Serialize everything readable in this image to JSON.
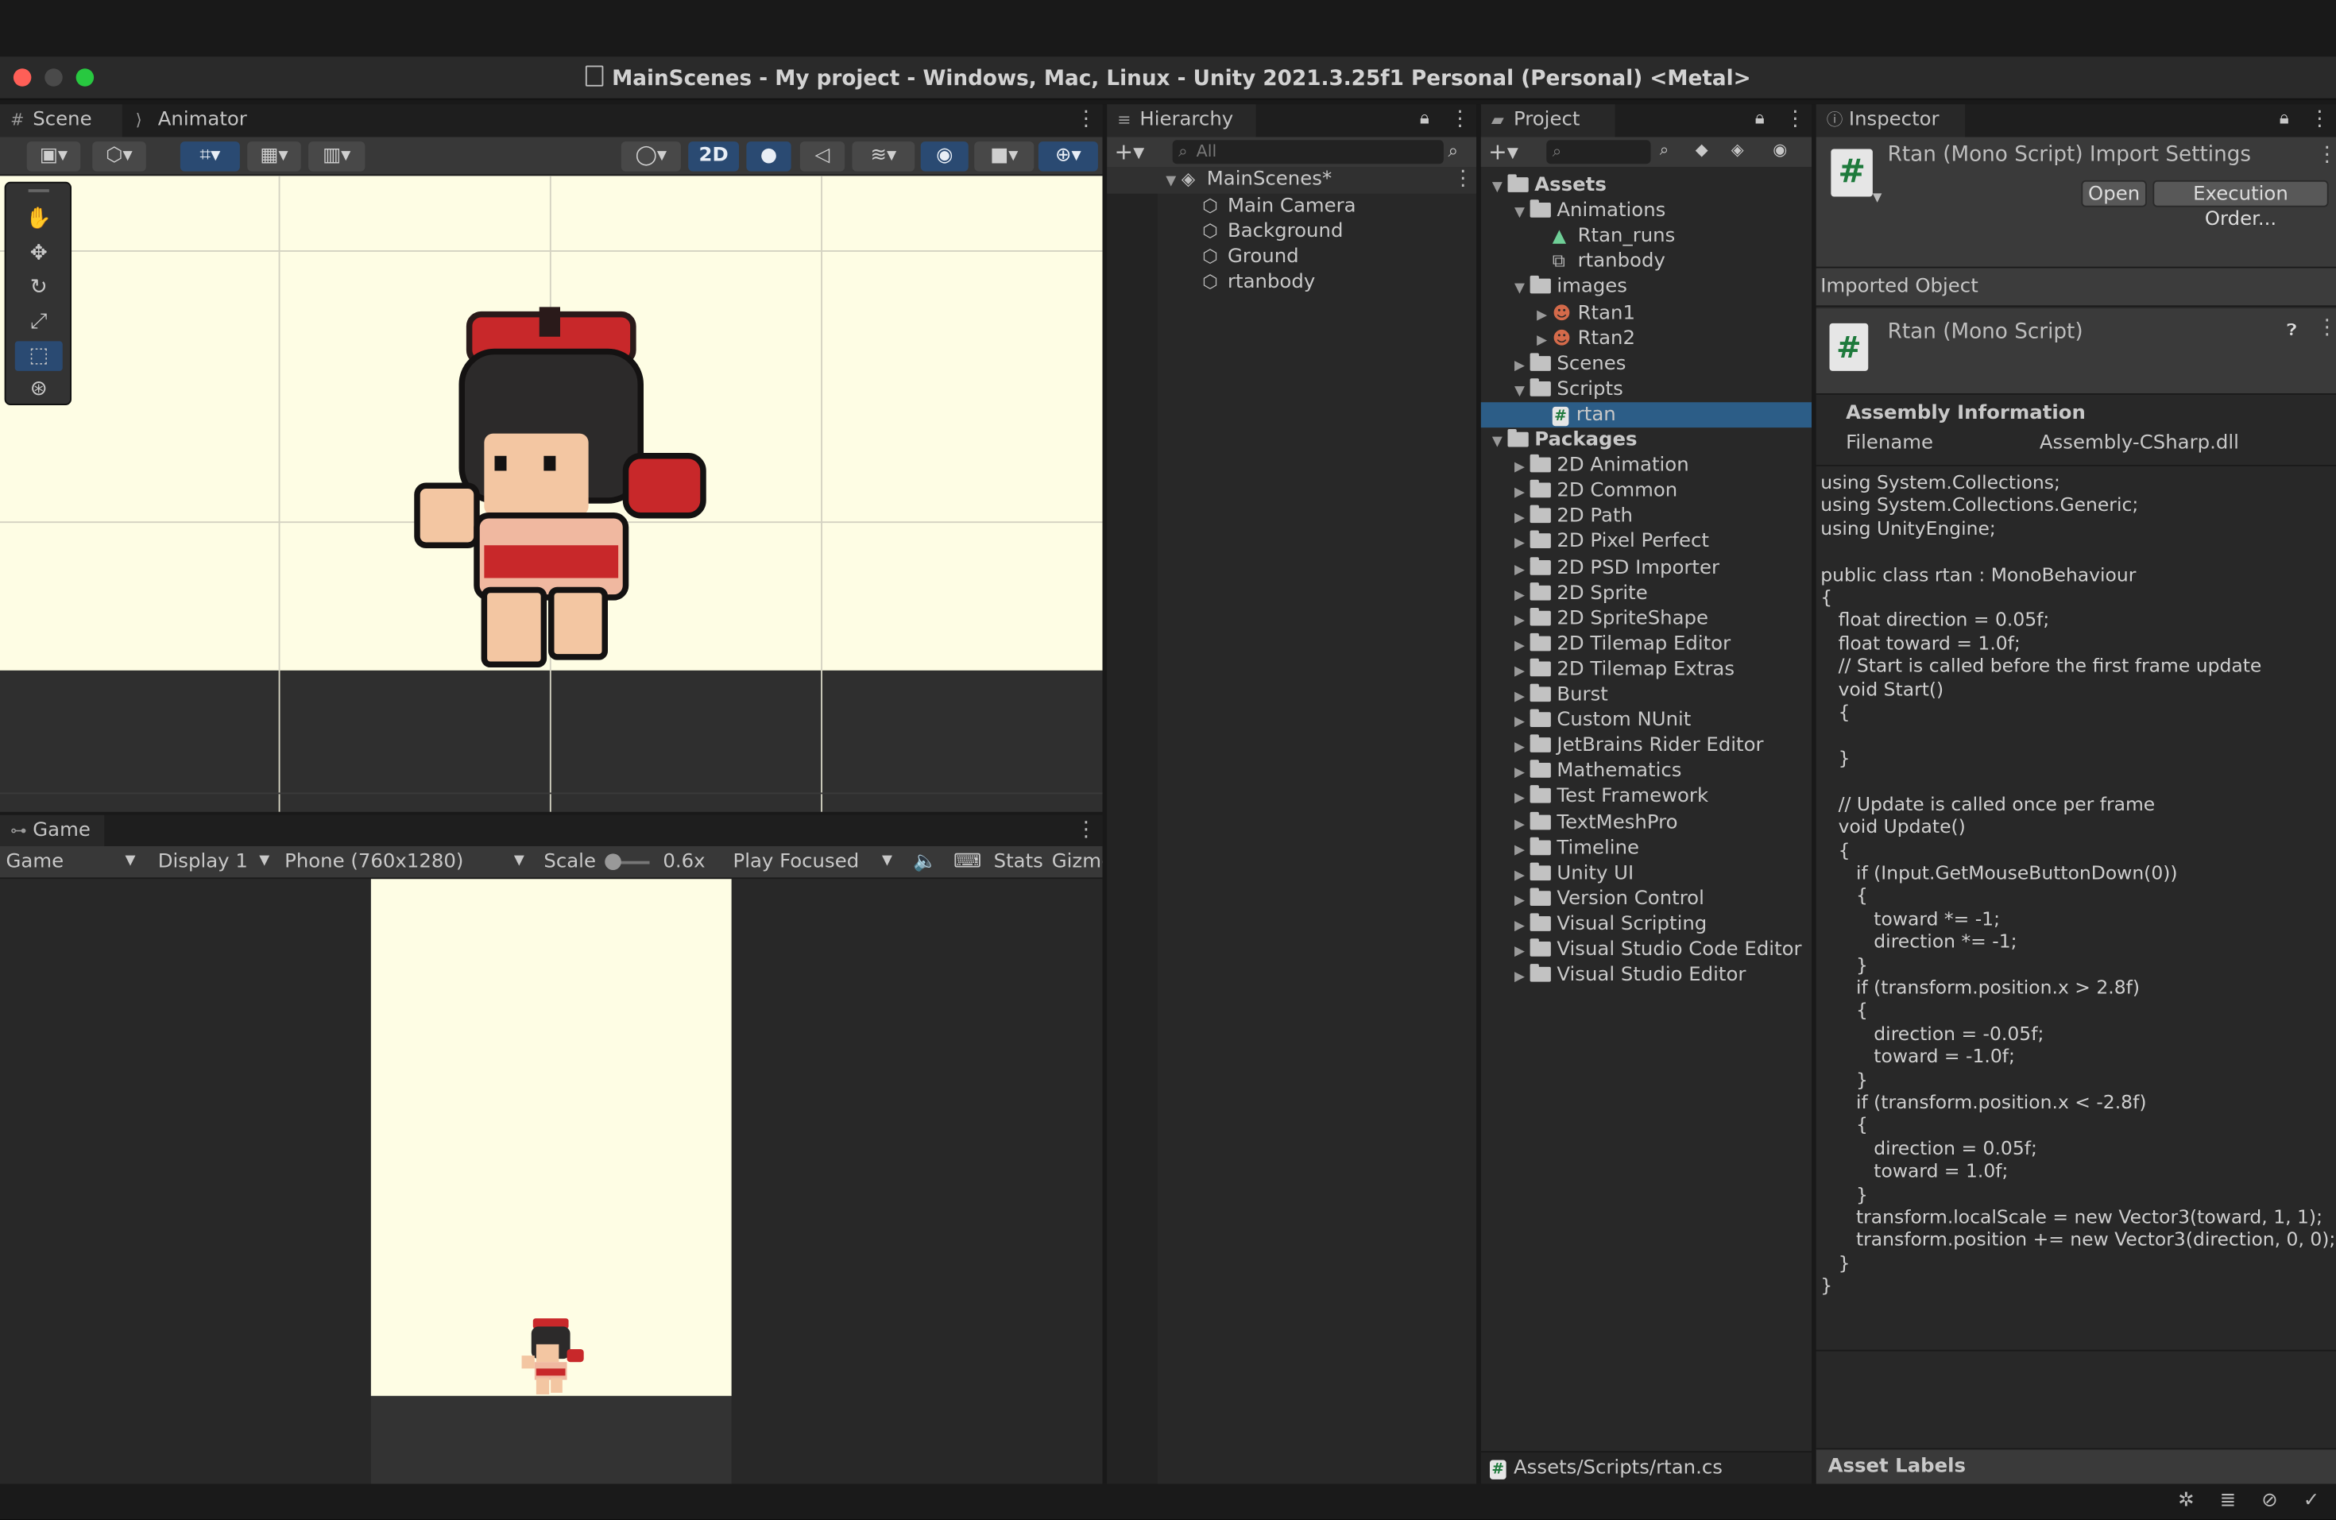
{
  "window": {
    "title": "MainScenes - My project - Windows, Mac, Linux - Unity 2021.3.25f1 Personal (Personal) <Metal>"
  },
  "scene": {
    "tabs": [
      {
        "label": "Scene"
      },
      {
        "label": "Animator"
      }
    ],
    "toolbar": {
      "mode2d_label": "2D"
    }
  },
  "game": {
    "tab_label": "Game",
    "toolbar": {
      "game_select": "Game",
      "display_select": "Display 1",
      "resolution_select": "Phone (760x1280)",
      "scale_label": "Scale",
      "scale_value": "0.6x",
      "play_mode_select": "Play Focused",
      "stats_label": "Stats",
      "gizmos_label": "Gizmo"
    }
  },
  "hierarchy": {
    "tab_label": "Hierarchy",
    "search_placeholder": "All",
    "scene_name": "MainScenes*",
    "items": [
      {
        "label": "Main Camera"
      },
      {
        "label": "Background"
      },
      {
        "label": "Ground"
      },
      {
        "label": "rtanbody"
      }
    ]
  },
  "project": {
    "tab_label": "Project",
    "tree": [
      {
        "label": "Assets",
        "indent": 0,
        "arrow": "down",
        "icon": "folder",
        "bold": true
      },
      {
        "label": "Animations",
        "indent": 1,
        "arrow": "down",
        "icon": "folder"
      },
      {
        "label": "Rtan_runs",
        "indent": 2,
        "arrow": "none",
        "icon": "anim"
      },
      {
        "label": "rtanbody",
        "indent": 2,
        "arrow": "none",
        "icon": "controller"
      },
      {
        "label": "images",
        "indent": 1,
        "arrow": "down",
        "icon": "folder"
      },
      {
        "label": "Rtan1",
        "indent": 2,
        "arrow": "right",
        "icon": "sprite"
      },
      {
        "label": "Rtan2",
        "indent": 2,
        "arrow": "right",
        "icon": "sprite"
      },
      {
        "label": "Scenes",
        "indent": 1,
        "arrow": "right",
        "icon": "folder"
      },
      {
        "label": "Scripts",
        "indent": 1,
        "arrow": "down",
        "icon": "folder"
      },
      {
        "label": "rtan",
        "indent": 2,
        "arrow": "none",
        "icon": "script",
        "selected": true
      },
      {
        "label": "Packages",
        "indent": 0,
        "arrow": "down",
        "icon": "folder",
        "bold": true
      },
      {
        "label": "2D Animation",
        "indent": 1,
        "arrow": "right",
        "icon": "folder"
      },
      {
        "label": "2D Common",
        "indent": 1,
        "arrow": "right",
        "icon": "folder"
      },
      {
        "label": "2D Path",
        "indent": 1,
        "arrow": "right",
        "icon": "folder"
      },
      {
        "label": "2D Pixel Perfect",
        "indent": 1,
        "arrow": "right",
        "icon": "folder"
      },
      {
        "label": "2D PSD Importer",
        "indent": 1,
        "arrow": "right",
        "icon": "folder"
      },
      {
        "label": "2D Sprite",
        "indent": 1,
        "arrow": "right",
        "icon": "folder"
      },
      {
        "label": "2D SpriteShape",
        "indent": 1,
        "arrow": "right",
        "icon": "folder"
      },
      {
        "label": "2D Tilemap Editor",
        "indent": 1,
        "arrow": "right",
        "icon": "folder"
      },
      {
        "label": "2D Tilemap Extras",
        "indent": 1,
        "arrow": "right",
        "icon": "folder"
      },
      {
        "label": "Burst",
        "indent": 1,
        "arrow": "right",
        "icon": "folder"
      },
      {
        "label": "Custom NUnit",
        "indent": 1,
        "arrow": "right",
        "icon": "folder"
      },
      {
        "label": "JetBrains Rider Editor",
        "indent": 1,
        "arrow": "right",
        "icon": "folder"
      },
      {
        "label": "Mathematics",
        "indent": 1,
        "arrow": "right",
        "icon": "folder"
      },
      {
        "label": "Test Framework",
        "indent": 1,
        "arrow": "right",
        "icon": "folder"
      },
      {
        "label": "TextMeshPro",
        "indent": 1,
        "arrow": "right",
        "icon": "folder"
      },
      {
        "label": "Timeline",
        "indent": 1,
        "arrow": "right",
        "icon": "folder"
      },
      {
        "label": "Unity UI",
        "indent": 1,
        "arrow": "right",
        "icon": "folder"
      },
      {
        "label": "Version Control",
        "indent": 1,
        "arrow": "right",
        "icon": "folder"
      },
      {
        "label": "Visual Scripting",
        "indent": 1,
        "arrow": "right",
        "icon": "folder"
      },
      {
        "label": "Visual Studio Code Editor",
        "indent": 1,
        "arrow": "right",
        "icon": "folder"
      },
      {
        "label": "Visual Studio Editor",
        "indent": 1,
        "arrow": "right",
        "icon": "folder"
      }
    ],
    "footer_path": "Assets/Scripts/rtan.cs"
  },
  "inspector": {
    "tab_label": "Inspector",
    "header_title": "Rtan (Mono Script) Import Settings",
    "open_button": "Open",
    "execution_order_button": "Execution Order...",
    "imported_object_label": "Imported Object",
    "object_title": "Rtan (Mono Script)",
    "assembly_info_label": "Assembly Information",
    "filename_label": "Filename",
    "filename_value": "Assembly-CSharp.dll",
    "code": "using System.Collections;\nusing System.Collections.Generic;\nusing UnityEngine;\n\npublic class rtan : MonoBehaviour\n{\n   float direction = 0.05f;\n   float toward = 1.0f;\n   // Start is called before the first frame update\n   void Start()\n   {\n\n   }\n\n   // Update is called once per frame\n   void Update()\n   {\n      if (Input.GetMouseButtonDown(0))\n      {\n         toward *= -1;\n         direction *= -1;\n      }\n      if (transform.position.x > 2.8f)\n      {\n         direction = -0.05f;\n         toward = -1.0f;\n      }\n      if (transform.position.x < -2.8f)\n      {\n         direction = 0.05f;\n         toward = 1.0f;\n      }\n      transform.localScale = new Vector3(toward, 1, 1);\n      transform.position += new Vector3(direction, 0, 0);\n   }\n}",
    "asset_labels": "Asset Labels"
  },
  "colors": {
    "accent_blue": "#2c5d87",
    "scene_background": "#fefde4",
    "traffic_red": "#ff5f57",
    "traffic_green": "#28c840"
  }
}
